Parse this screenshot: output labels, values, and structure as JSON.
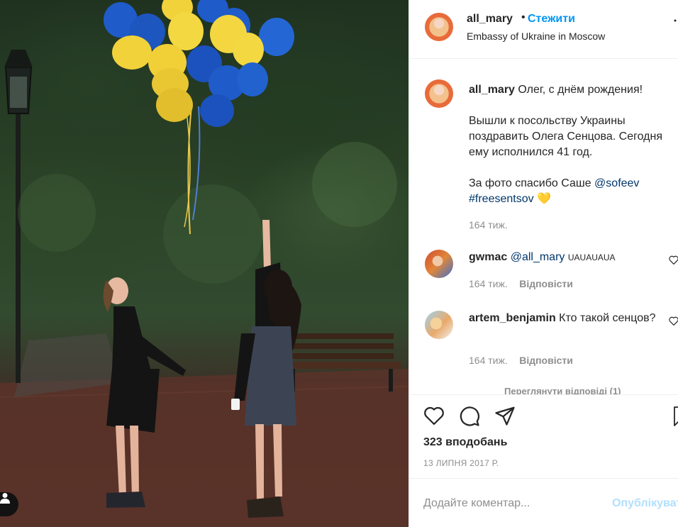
{
  "header": {
    "username": "all_mary",
    "dot": "•",
    "follow_label": "Стежити",
    "location": "Embassy of Ukraine in Moscow"
  },
  "caption": {
    "username": "all_mary",
    "line1": "Олег, с днём рождения!",
    "para2": "Вышли к посольству Украины поздравить Олега Сенцова. Сегодня ему исполнился 41 год.",
    "para3_text": "За фото спасибо Саше",
    "para3_mention": "@sofeev",
    "hashtag": "#freesentsov",
    "emoji": "💛",
    "time": "164 тиж."
  },
  "comments": [
    {
      "username": "gwmac",
      "mention": "@all_mary",
      "text": "UAUAUAUA",
      "time": "164 тиж.",
      "reply_label": "Відповісти"
    },
    {
      "username": "artem_benjamin",
      "text": "Кто такой сенцов?",
      "time": "164 тиж.",
      "reply_label": "Відповісти"
    }
  ],
  "view_replies": "Переглянути відповіді (1)",
  "actions": {
    "like_icon": "heart-icon",
    "comment_icon": "comment-icon",
    "share_icon": "share-icon",
    "save_icon": "bookmark-icon"
  },
  "likes": "323 вподобань",
  "date": "13 ЛИПНЯ 2017 Р.",
  "add_comment": {
    "placeholder": "Додайте коментар...",
    "publish_label": "Опублікувати"
  },
  "colors": {
    "accent": "#0095f6",
    "publish_disabled": "#b2dffc",
    "mention": "#00376b",
    "muted": "#8e8e8e",
    "balloon_blue": "#1f5bc9",
    "balloon_yellow": "#f2d23a"
  }
}
